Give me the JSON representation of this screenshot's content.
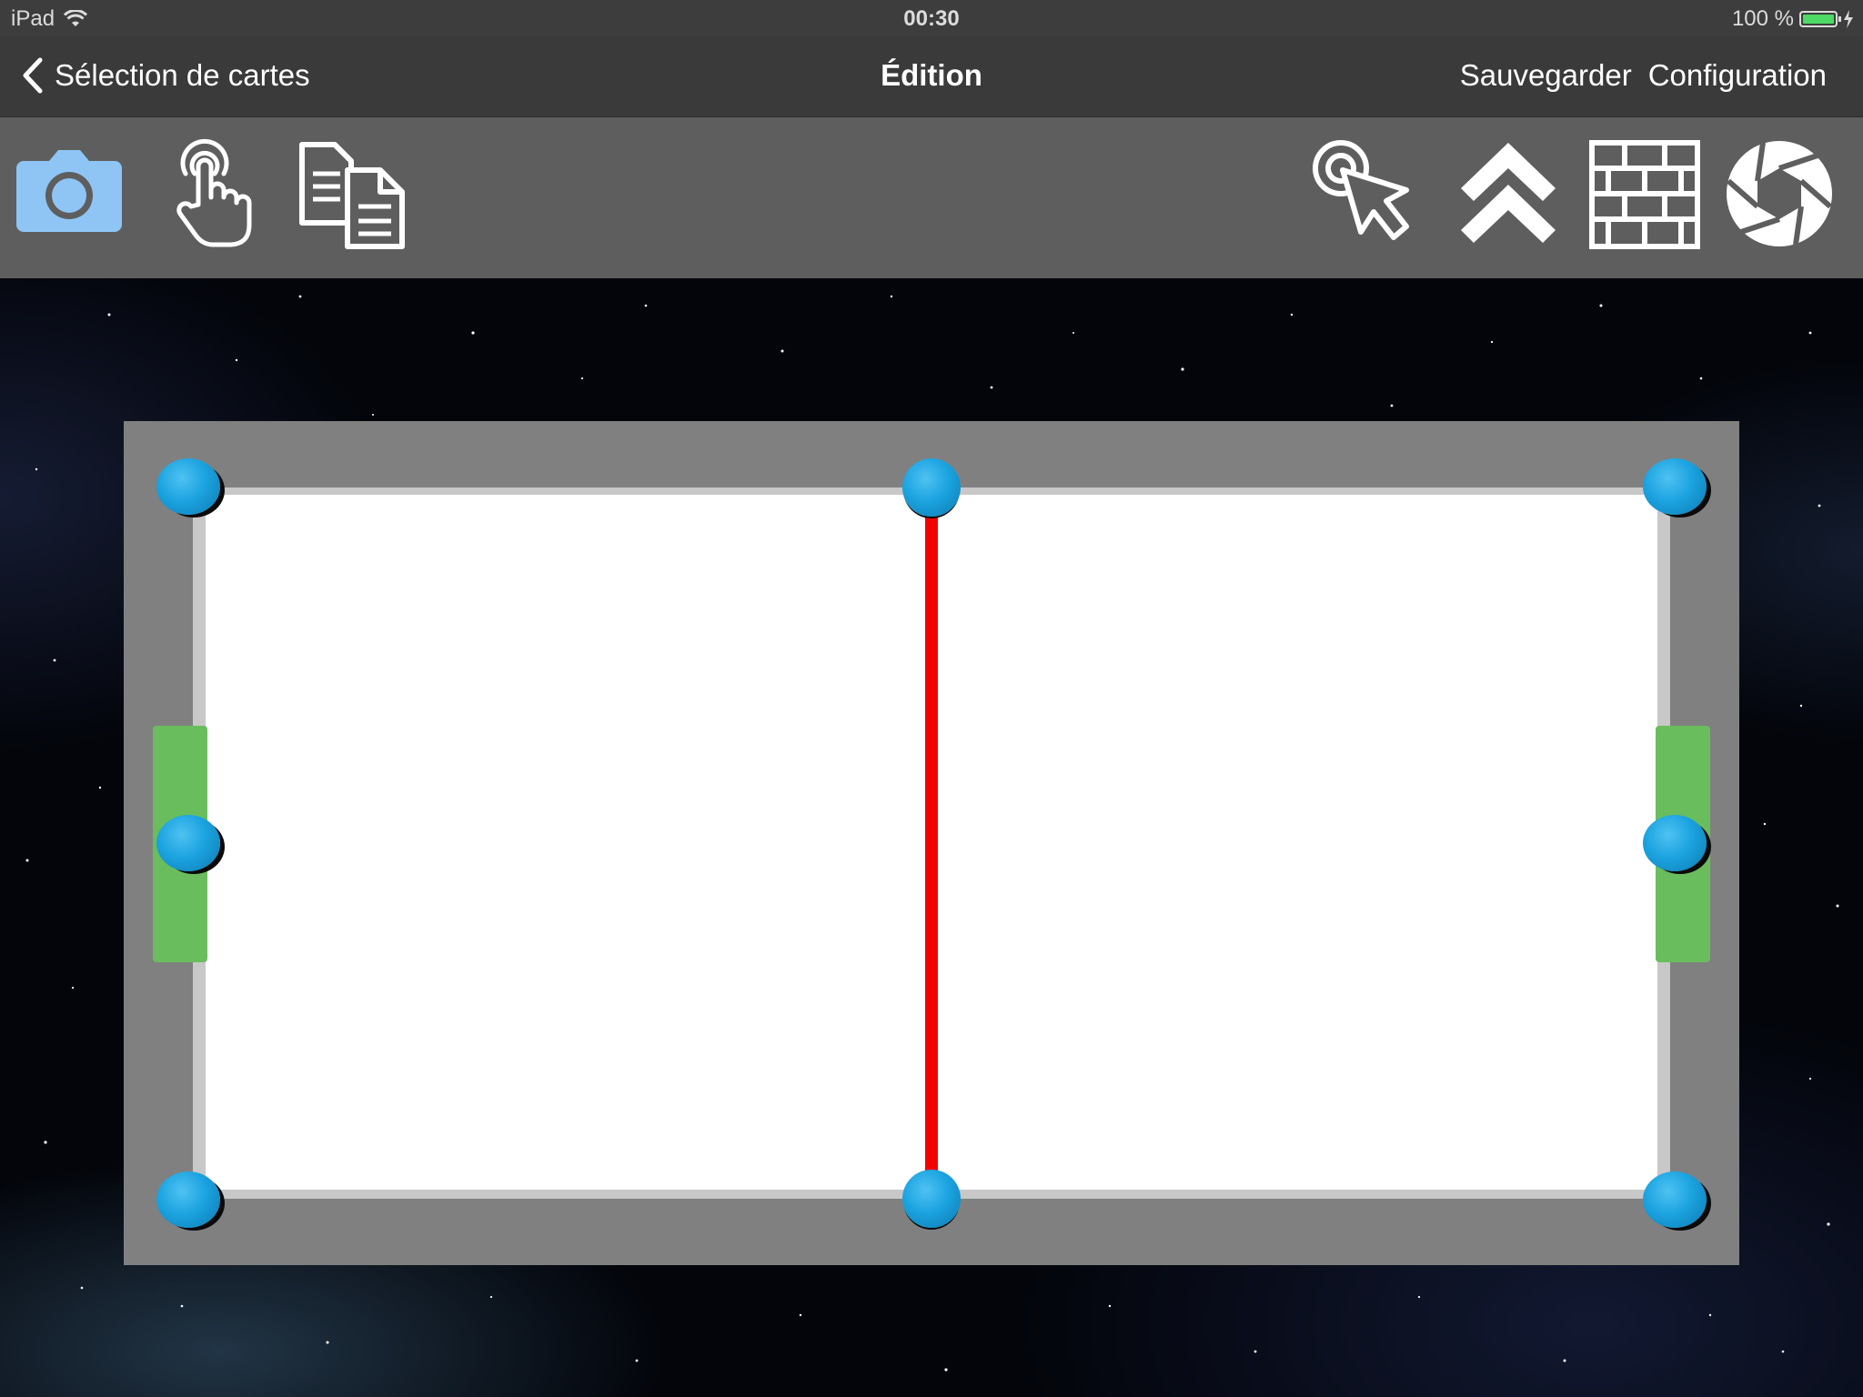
{
  "status_bar": {
    "device": "iPad",
    "time": "00:30",
    "battery_percent": "100 %",
    "battery_color": "#4cd964"
  },
  "nav": {
    "back_label": "Sélection de cartes",
    "title": "Édition",
    "save_label": "Sauvegarder",
    "config_label": "Configuration"
  },
  "toolbar": {
    "left_tools": [
      "camera-icon",
      "touch-icon",
      "copy-icon"
    ],
    "right_tools": [
      "cursor-target-icon",
      "double-chevron-up-icon",
      "wall-icon",
      "aperture-icon"
    ],
    "camera_accent": "#8ec5f5",
    "icon_color": "#ffffff"
  },
  "scene": {
    "table_border_color": "#808080",
    "field_color": "#ffffff",
    "midline_color": "#f40000",
    "goal_color": "#6abd5d",
    "handle_color": "#1ba3e0",
    "handles": [
      "top-left",
      "top-center",
      "top-right",
      "mid-left",
      "mid-right",
      "bottom-left",
      "bottom-center",
      "bottom-right"
    ]
  }
}
